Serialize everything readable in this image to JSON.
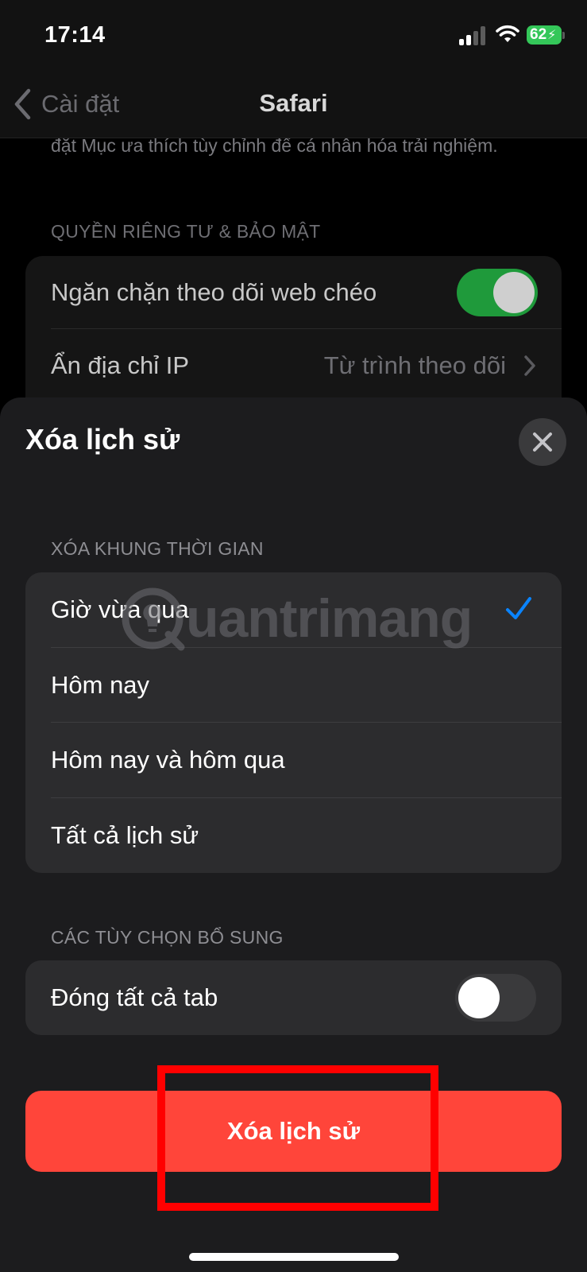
{
  "status_bar": {
    "time": "17:14",
    "battery_level": "62",
    "battery_color": "#34c759",
    "icons": [
      "cellular-signal-icon",
      "wifi-icon",
      "battery-charging-icon"
    ]
  },
  "nav": {
    "back_label": "Cài đặt",
    "title": "Safari"
  },
  "background_settings": {
    "description": "đặt Mục ưa thích tùy chỉnh để cá nhân hóa trải nghiệm.",
    "section_header": "QUYỀN RIÊNG TƯ & BẢO MẬT",
    "rows": [
      {
        "label": "Ngăn chặn theo dõi web chéo",
        "toggle_on": true
      },
      {
        "label": "Ẩn địa chỉ IP",
        "value": "Từ trình theo dõi"
      }
    ]
  },
  "sheet": {
    "title": "Xóa lịch sử",
    "timeframe_header": "XÓA KHUNG THỜI GIAN",
    "timeframe_options": [
      {
        "label": "Giờ vừa qua",
        "selected": true
      },
      {
        "label": "Hôm nay",
        "selected": false
      },
      {
        "label": "Hôm nay và hôm qua",
        "selected": false
      },
      {
        "label": "Tất cả lịch sử",
        "selected": false
      }
    ],
    "additional_header": "CÁC TÙY CHỌN BỔ SUNG",
    "close_all_tabs": {
      "label": "Đóng tất cả tab",
      "toggle_on": false
    },
    "clear_button_label": "Xóa lịch sử"
  },
  "watermark": {
    "text": "uantrimang"
  },
  "colors": {
    "accent": "#0a84ff",
    "destructive": "#ff453a",
    "toggle_on": "#1f9a3b",
    "highlight": "#ff0000"
  }
}
